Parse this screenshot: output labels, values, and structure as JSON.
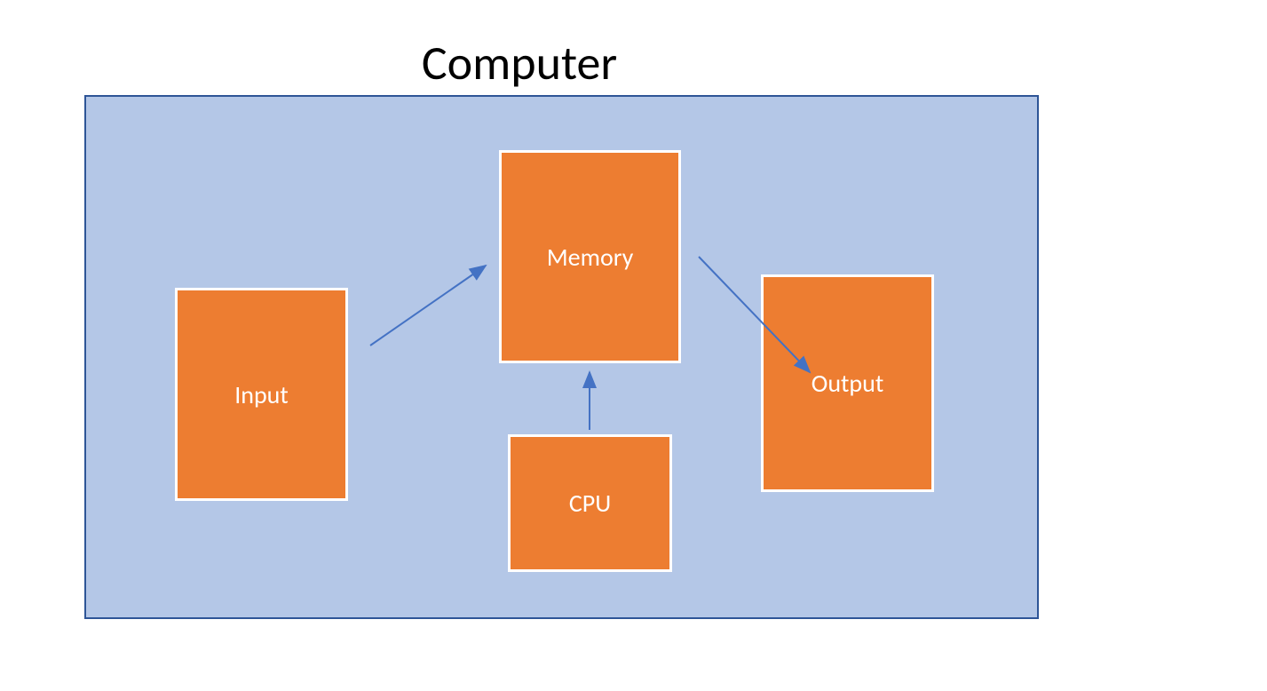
{
  "title": "Computer",
  "container": {
    "label": "computer-architecture-container"
  },
  "boxes": {
    "input": {
      "label": "Input"
    },
    "memory": {
      "label": "Memory"
    },
    "cpu": {
      "label": "CPU"
    },
    "output": {
      "label": "Output"
    }
  },
  "arrows": [
    {
      "from": "input",
      "to": "memory"
    },
    {
      "from": "cpu",
      "to": "memory"
    },
    {
      "from": "memory",
      "to": "output"
    }
  ],
  "colors": {
    "container_fill": "#B4C7E7",
    "container_border": "#2E5597",
    "box_fill": "#ED7D31",
    "box_border": "#FFFFFF",
    "arrow": "#4472C4",
    "title_text": "#000000",
    "box_text": "#FFFFFF"
  }
}
